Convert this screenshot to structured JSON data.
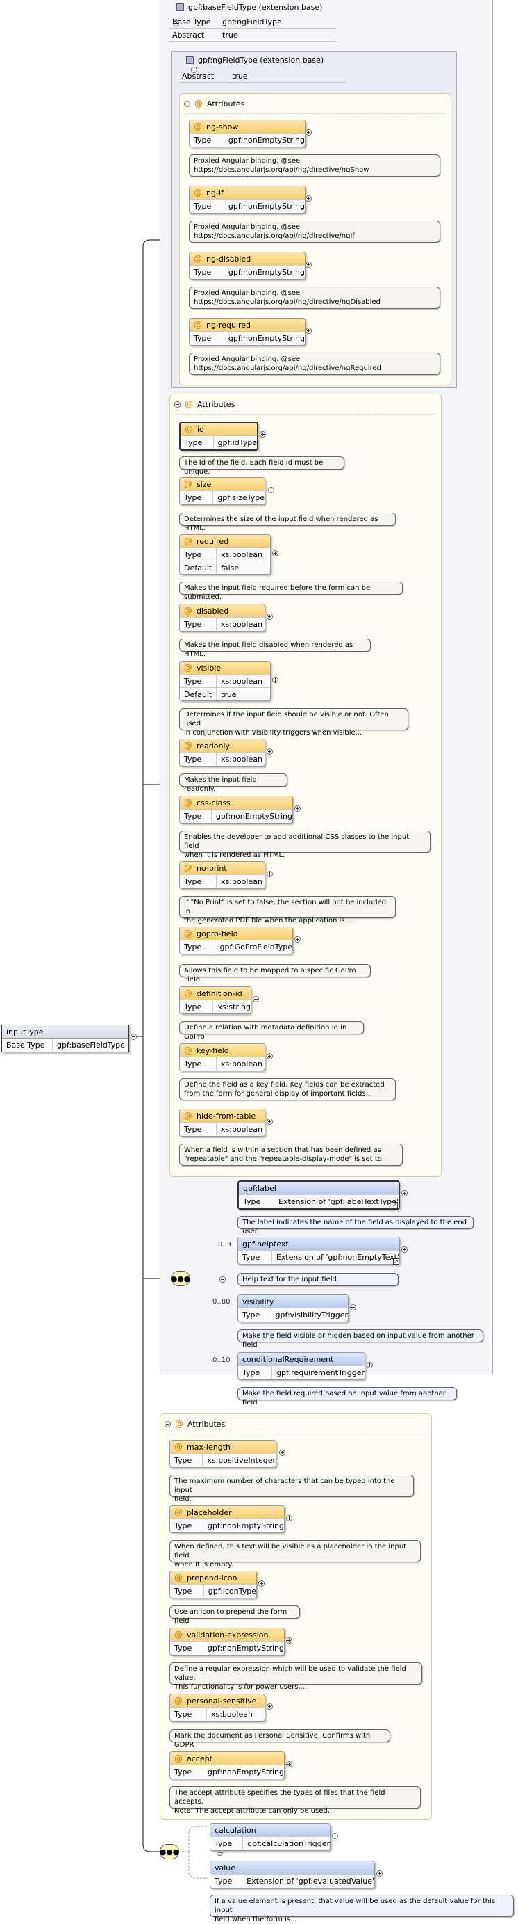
{
  "root": {
    "name": "inputType",
    "base_label": "Base Type",
    "base_value": "gpf:baseFieldType"
  },
  "base_ext": {
    "title": "gpf:baseFieldType (extension base)",
    "rows": [
      {
        "k": "Base Type",
        "v": "gpf:ngFieldType"
      },
      {
        "k": "Abstract",
        "v": "true"
      }
    ]
  },
  "ng_ext": {
    "title": "gpf:ngFieldType (extension base)",
    "rows": [
      {
        "k": "Abstract",
        "v": "true"
      }
    ]
  },
  "attributes_label": "Attributes",
  "ng_attrs": [
    {
      "name": "ng-show",
      "rows": [
        {
          "k": "Type",
          "v": "gpf:nonEmptyString"
        }
      ],
      "doc": [
        "Proxied Angular binding. @see",
        "https://docs.angularjs.org/api/ng/directive/ngShow"
      ]
    },
    {
      "name": "ng-if",
      "rows": [
        {
          "k": "Type",
          "v": "gpf:nonEmptyString"
        }
      ],
      "doc": [
        "Proxied Angular binding. @see",
        "https://docs.angularjs.org/api/ng/directive/ngIf"
      ]
    },
    {
      "name": "ng-disabled",
      "rows": [
        {
          "k": "Type",
          "v": "gpf:nonEmptyString"
        }
      ],
      "doc": [
        "Proxied Angular binding. @see",
        "https://docs.angularjs.org/api/ng/directive/ngDisabled"
      ]
    },
    {
      "name": "ng-required",
      "rows": [
        {
          "k": "Type",
          "v": "gpf:nonEmptyString"
        }
      ],
      "doc": [
        "Proxied Angular binding. @see",
        "https://docs.angularjs.org/api/ng/directive/ngRequired"
      ]
    }
  ],
  "base_attrs": [
    {
      "name": "id",
      "rows": [
        {
          "k": "Type",
          "v": "gpf:idType"
        }
      ],
      "doc": [
        "The Id of the field. Each field Id must be unique."
      ]
    },
    {
      "name": "size",
      "rows": [
        {
          "k": "Type",
          "v": "gpf:sizeType"
        }
      ],
      "doc": [
        "Determines the size of the input field when rendered as HTML."
      ]
    },
    {
      "name": "required",
      "rows": [
        {
          "k": "Type",
          "v": "xs:boolean"
        },
        {
          "k": "Default",
          "v": "false"
        }
      ],
      "doc": [
        "Makes the input field required before the form can be submitted."
      ]
    },
    {
      "name": "disabled",
      "rows": [
        {
          "k": "Type",
          "v": "xs:boolean"
        }
      ],
      "doc": [
        "Makes the input field disabled when rendered as HTML."
      ]
    },
    {
      "name": "visible",
      "rows": [
        {
          "k": "Type",
          "v": "xs:boolean"
        },
        {
          "k": "Default",
          "v": "true"
        }
      ],
      "doc": [
        "Determines if the input field should be visible or not. Often used",
        "in conjunction with visibility triggers when visible..."
      ]
    },
    {
      "name": "readonly",
      "rows": [
        {
          "k": "Type",
          "v": "xs:boolean"
        }
      ],
      "doc": [
        "Makes the input field readonly."
      ]
    },
    {
      "name": "css-class",
      "rows": [
        {
          "k": "Type",
          "v": "gpf:nonEmptyString"
        }
      ],
      "doc": [
        "Enables the developer to add additional CSS classes to the input field",
        "when it is rendered as HTML."
      ]
    },
    {
      "name": "no-print",
      "rows": [
        {
          "k": "Type",
          "v": "xs:boolean"
        }
      ],
      "doc": [
        "If \"No Print\" is set to false, the section will not be included in",
        "the generated PDF file when the application is..."
      ]
    },
    {
      "name": "gopro-field",
      "rows": [
        {
          "k": "Type",
          "v": "gpf:GoProFieldType"
        }
      ],
      "doc": [
        "Allows this field to be mapped to a specific GoPro Field."
      ]
    },
    {
      "name": "definition-id",
      "rows": [
        {
          "k": "Type",
          "v": "xs:string"
        }
      ],
      "doc": [
        "Define a relation with metadata definition Id in GoPro"
      ]
    },
    {
      "name": "key-field",
      "rows": [
        {
          "k": "Type",
          "v": "xs:boolean"
        }
      ],
      "doc": [
        "Define the field as a key field. Key fields can be extracted",
        "from the form for general display of important fields..."
      ]
    },
    {
      "name": "hide-from-table",
      "rows": [
        {
          "k": "Type",
          "v": "xs:boolean"
        }
      ],
      "doc": [
        "When a field is within a section that has been defined as",
        "\"repeatable\" and the \"repeatable-display-mode\" is set to..."
      ]
    }
  ],
  "seq_elems": [
    {
      "name": "gpf:label",
      "card": "",
      "rows": [
        {
          "k": "Type",
          "v": "Extension of 'gpf:labelTextType'"
        }
      ],
      "doc": [
        "The label indicates the name of the field as displayed to the end user."
      ]
    },
    {
      "name": "gpf:helptext",
      "card": "0..3",
      "rows": [
        {
          "k": "Type",
          "v": "Extension of 'gpf:nonEmptyText'"
        }
      ],
      "doc": [
        "Help text for the input field."
      ]
    },
    {
      "name": "visibility",
      "card": "0..80",
      "rows": [
        {
          "k": "Type",
          "v": "gpf:visibilityTrigger"
        }
      ],
      "doc": [
        "Make the field visible or hidden based on input value from another field"
      ]
    },
    {
      "name": "conditionalRequirement",
      "card": "0..10",
      "rows": [
        {
          "k": "Type",
          "v": "gpf:requirementTrigger"
        }
      ],
      "doc": [
        "Make the field required based on input value from another field"
      ]
    }
  ],
  "input_attrs": [
    {
      "name": "max-length",
      "rows": [
        {
          "k": "Type",
          "v": "xs:positiveInteger"
        }
      ],
      "doc": [
        "The maximum number of characters that can be typed into the input",
        "field."
      ]
    },
    {
      "name": "placeholder",
      "rows": [
        {
          "k": "Type",
          "v": "gpf:nonEmptyString"
        }
      ],
      "doc": [
        "When defined, this text will be visible as a placeholder in the input field",
        "when it is empty."
      ]
    },
    {
      "name": "prepend-icon",
      "rows": [
        {
          "k": "Type",
          "v": "gpf:iconType"
        }
      ],
      "doc": [
        "Use an icon to prepend the form field"
      ]
    },
    {
      "name": "validation-expression",
      "rows": [
        {
          "k": "Type",
          "v": "gpf:nonEmptyString"
        }
      ],
      "doc": [
        "Define a regular expression which will be used to validate the field value.",
        "This functionality is for power users,..."
      ]
    },
    {
      "name": "personal-sensitive",
      "rows": [
        {
          "k": "Type",
          "v": "xs:boolean"
        }
      ],
      "doc": [
        "Mark the document as Personal Sensitive. Confirms with GDPR"
      ]
    },
    {
      "name": "accept",
      "rows": [
        {
          "k": "Type",
          "v": "gpf:nonEmptyString"
        }
      ],
      "doc": [
        "The accept attribute specifies the types of files that the field accepts.",
        "Note: The accept attribute can only be used..."
      ]
    }
  ],
  "final_elems": [
    {
      "name": "calculation",
      "rows": [
        {
          "k": "Type",
          "v": "gpf:calculationTrigger"
        }
      ],
      "doc": []
    },
    {
      "name": "value",
      "rows": [
        {
          "k": "Type",
          "v": "Extension of 'gpf:evaluatedValue'"
        }
      ],
      "doc": [
        "If a value element is present, that value will be used as the default value for this input",
        "field when the form is..."
      ]
    }
  ],
  "colors": {
    "attr_header": "#f5cf74",
    "elem_header": "#b8cbef",
    "doc_bg": "#f6f6ee",
    "panel_bg": "#f4f4f9"
  }
}
